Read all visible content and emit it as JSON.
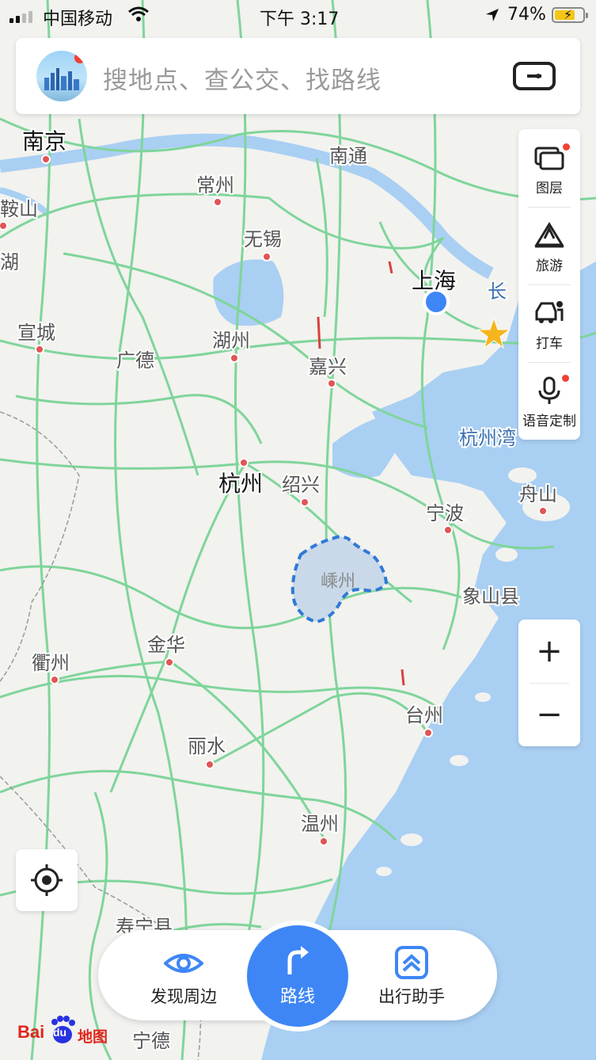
{
  "status_bar": {
    "carrier": "中国移动",
    "time": "下午 3:17",
    "battery_percent": "74%",
    "battery_level": 0.74,
    "icons": [
      "signal-icon",
      "wifi-icon",
      "location-arrow-icon",
      "battery-charging-icon"
    ]
  },
  "search": {
    "placeholder": "搜地点、查公交、找路线",
    "icons": [
      "avatar-icon",
      "scan-icon"
    ]
  },
  "side_panel": {
    "items": [
      {
        "label": "图层",
        "icon": "layers-icon"
      },
      {
        "label": "旅游",
        "icon": "travel-icon"
      },
      {
        "label": "打车",
        "icon": "taxi-icon"
      },
      {
        "label": "语音定制",
        "icon": "microphone-icon"
      }
    ]
  },
  "zoom": {
    "in": "+",
    "out": "−"
  },
  "locate": {
    "icon": "locate-icon"
  },
  "bottom_nav": {
    "discover": "发现周边",
    "route": "路线",
    "assistant": "出行助手",
    "icons": [
      "eye-icon",
      "route-arrow-icon",
      "chevron-up-icon"
    ]
  },
  "brand": {
    "bai": "Bai",
    "du": "du",
    "ditu": "地图"
  },
  "map": {
    "cities": {
      "nanjing": "南京",
      "nantong": "南通",
      "changzhou": "常州",
      "wuxi": "无锡",
      "maanshan": "鞍山",
      "hu": "湖",
      "shanghai": "上海",
      "chang": "长",
      "xuancheng": "宣城",
      "guangde": "广德",
      "huzhou": "湖州",
      "jiaxing": "嘉兴",
      "hangzhouwan": "杭州湾",
      "hangzhou": "杭州",
      "shaoxing": "绍兴",
      "ningbo": "宁波",
      "zhoushan": "舟山",
      "shengzhou": "嵊州",
      "xiangshan": "象山县",
      "quzhou": "衢州",
      "jinhua": "金华",
      "taizhou": "台州",
      "lishui": "丽水",
      "wenzhou": "温州",
      "ningde": "宁德",
      "shouning": "寿宁县"
    },
    "colors": {
      "land": "#f2f2ef",
      "water": "#a9cff3",
      "road": "#7fd59a",
      "highlight_border": "#2f79d6",
      "highlight_fill": "#c9d9ea",
      "user_dot": "#3e86f5",
      "city_dot": "#e05555",
      "star": "#f5b51e"
    }
  }
}
